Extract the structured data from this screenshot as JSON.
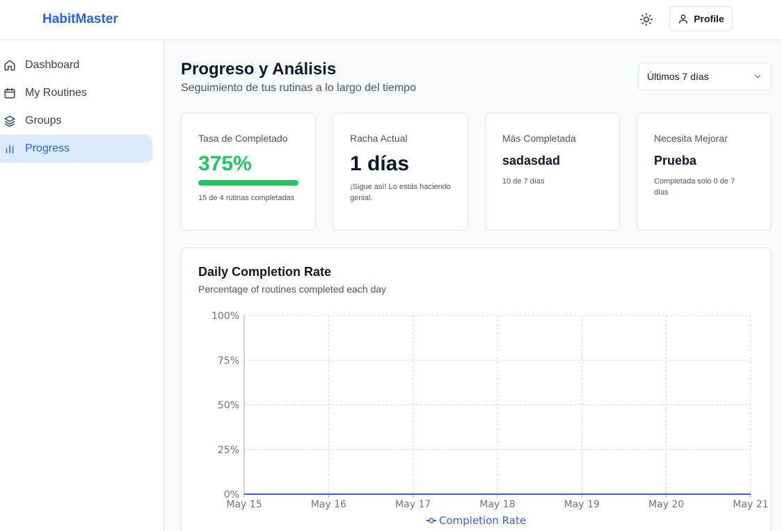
{
  "header": {
    "brand": "HabitMaster",
    "profile_label": "Profile",
    "theme_icon": "sun-icon",
    "profile_icon": "user-icon"
  },
  "sidebar": {
    "items": [
      {
        "label": "Dashboard",
        "icon": "home-icon",
        "active": false
      },
      {
        "label": "My Routines",
        "icon": "calendar-icon",
        "active": false
      },
      {
        "label": "Groups",
        "icon": "layers-icon",
        "active": false
      },
      {
        "label": "Progress",
        "icon": "bar-chart-icon",
        "active": true
      }
    ]
  },
  "main": {
    "title": "Progreso y Análisis",
    "subtitle": "Seguimiento de tus rutinas a lo largo del tiempo",
    "range_select": {
      "value": "Últimos 7 días"
    }
  },
  "cards": [
    {
      "label": "Tasa de Completado",
      "value": "375%",
      "note": "15 de 4 rutinas completadas",
      "progress_percent": 100
    },
    {
      "label": "Racha Actual",
      "value": "1 días",
      "note": "¡Sigue así! Lo estás haciendo genial."
    },
    {
      "label": "Más Completada",
      "value": "sadasdad",
      "note": "10 de 7 días"
    },
    {
      "label": "Necesita Mejorar",
      "value": "Prueba",
      "note": "Completada solo 0 de 7 días"
    }
  ],
  "colors": {
    "brand": "#2563eb",
    "success": "#22c55e",
    "line": "#3b5bdb",
    "active_bg": "#dbeafe"
  },
  "chart_data": {
    "type": "line",
    "title": "Daily Completion Rate",
    "subtitle": "Percentage of routines completed each day",
    "x": [
      "May 15",
      "May 16",
      "May 17",
      "May 18",
      "May 19",
      "May 20",
      "May 21"
    ],
    "series": [
      {
        "name": "Completion Rate",
        "values": [
          0,
          0,
          0,
          0,
          0,
          0,
          0
        ]
      }
    ],
    "y_ticks": [
      "0%",
      "25%",
      "50%",
      "75%",
      "100%"
    ],
    "ylim": [
      0,
      100
    ],
    "grid": true,
    "legend": "bottom"
  }
}
